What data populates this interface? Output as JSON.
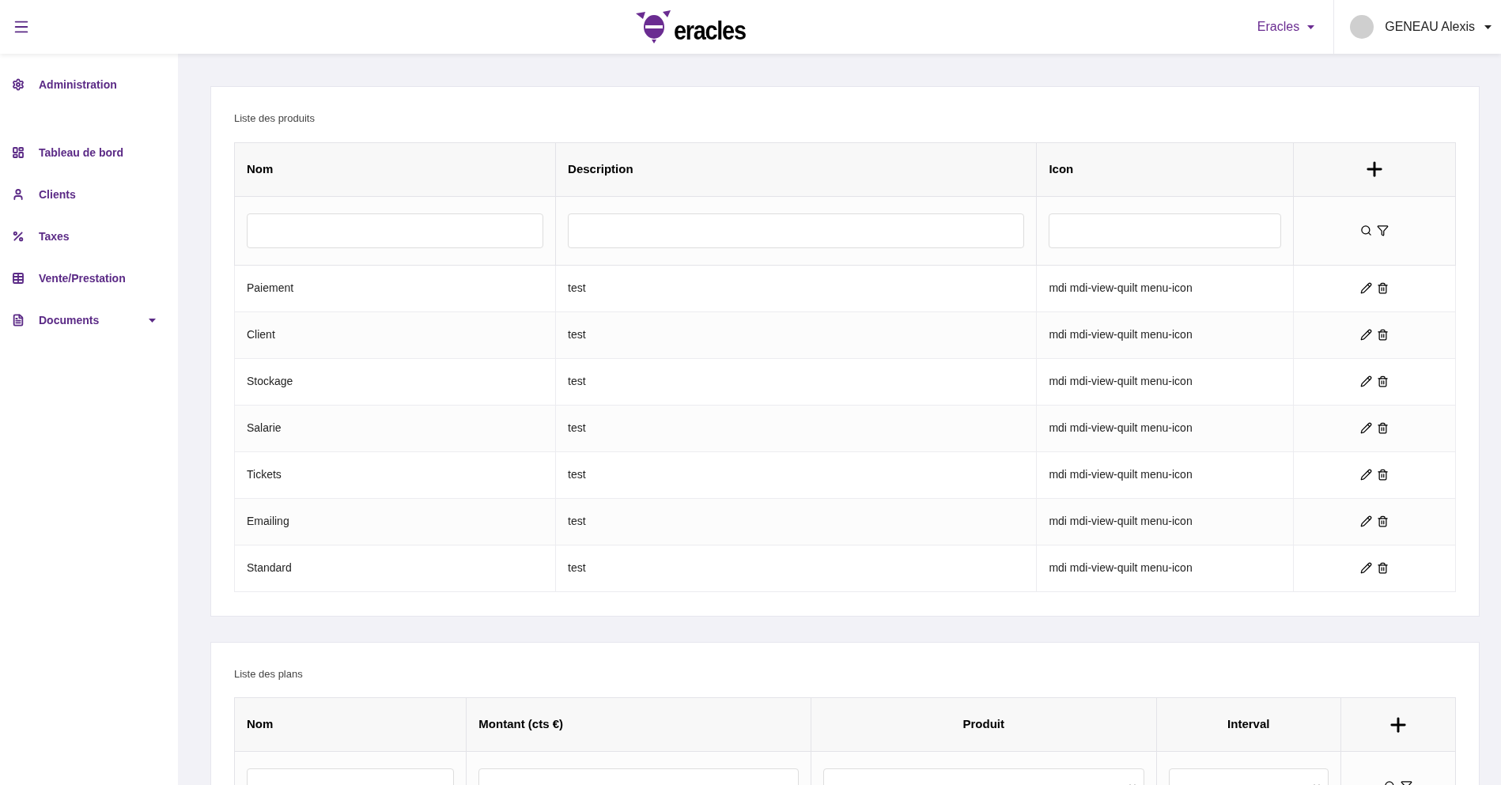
{
  "header": {
    "logo_text": "eracles",
    "org_menu": "Eracles",
    "user": {
      "name": "GENEAU Alexis"
    }
  },
  "sidebar": {
    "items": [
      {
        "label": "Administration",
        "expandable": false
      },
      {
        "label": "Tableau de bord",
        "expandable": false
      },
      {
        "label": "Clients",
        "expandable": false
      },
      {
        "label": "Taxes",
        "expandable": false
      },
      {
        "label": "Vente/Prestation",
        "expandable": false
      },
      {
        "label": "Documents",
        "expandable": true
      }
    ]
  },
  "cards": [
    {
      "title": "Liste des produits",
      "columns": [
        "Nom",
        "Description",
        "Icon"
      ],
      "filters": [
        {
          "kind": "input"
        },
        {
          "kind": "input"
        },
        {
          "kind": "input"
        }
      ],
      "rows": [
        [
          "Paiement",
          "test",
          "mdi mdi-view-quilt menu-icon"
        ],
        [
          "Client",
          "test",
          "mdi mdi-view-quilt menu-icon"
        ],
        [
          "Stockage",
          "test",
          "mdi mdi-view-quilt menu-icon"
        ],
        [
          "Salarie",
          "test",
          "mdi mdi-view-quilt menu-icon"
        ],
        [
          "Tickets",
          "test",
          "mdi mdi-view-quilt menu-icon"
        ],
        [
          "Emailing",
          "test",
          "mdi mdi-view-quilt menu-icon"
        ],
        [
          "Standard",
          "test",
          "mdi mdi-view-quilt menu-icon"
        ]
      ]
    },
    {
      "title": "Liste des plans",
      "columns": [
        "Nom",
        "Montant (cts €)",
        "Produit",
        "Interval"
      ],
      "filters": [
        {
          "kind": "input"
        },
        {
          "kind": "input"
        },
        {
          "kind": "select"
        },
        {
          "kind": "select"
        }
      ]
    }
  ]
}
